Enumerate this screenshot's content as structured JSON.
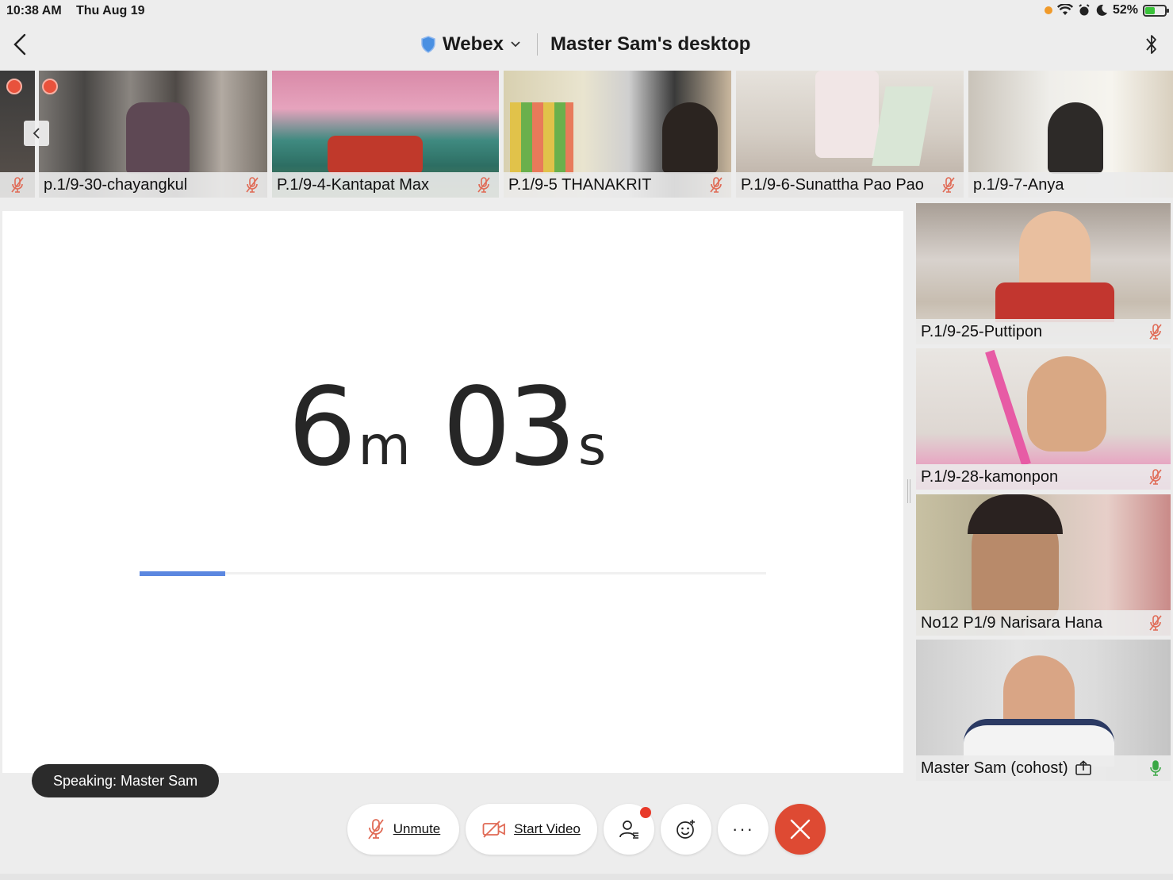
{
  "status_bar": {
    "time": "10:38 AM",
    "date": "Thu Aug 19",
    "battery": "52%",
    "battery_level": 0.52
  },
  "header": {
    "app_name": "Webex",
    "share_title": "Master Sam's desktop"
  },
  "strip_participants": [
    {
      "name": "p.1/9-30-chayangkul"
    },
    {
      "name": "P.1/9-4-Kantapat Max"
    },
    {
      "name": "P.1/9-5 THANAKRIT"
    },
    {
      "name": "P.1/9-6-Sunattha Pao Pao"
    },
    {
      "name": "p.1/9-7-Anya"
    }
  ],
  "side_participants": [
    {
      "name": "P.1/9-25-Puttipon"
    },
    {
      "name": "P.1/9-28-kamonpon"
    },
    {
      "name": "No12 P1/9 Narisara Hana"
    },
    {
      "name": "Master Sam (cohost)"
    }
  ],
  "timer": {
    "minutes": "6",
    "minutes_unit": "m",
    "seconds": "03",
    "seconds_unit": "s",
    "progress": 0.137
  },
  "speaking": "Speaking: Master Sam",
  "controls": {
    "unmute": "Unmute",
    "start_video": "Start Video",
    "more": "···"
  },
  "colors": {
    "accent": "#5b87e0",
    "end_call": "#de4a33",
    "mic_off": "#e06a55",
    "mic_on": "#3aa845"
  }
}
